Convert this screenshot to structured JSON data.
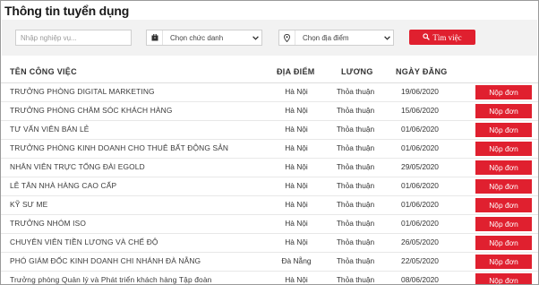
{
  "page": {
    "title": "Thông tin tuyển dụng"
  },
  "filters": {
    "keyword_placeholder": "Nhập nghiệp vụ...",
    "job_title_select": {
      "value": "Chọn chức danh",
      "icon": "briefcase-icon"
    },
    "location_select": {
      "value": "Chọn địa điểm",
      "icon": "map-marker-icon"
    },
    "search_button": {
      "label": "Tìm việc",
      "icon": "search-icon"
    }
  },
  "table": {
    "headers": {
      "title": "TÊN CÔNG VIỆC",
      "place": "ĐỊA ĐIỂM",
      "salary": "LƯƠNG",
      "date": "NGÀY ĐĂNG"
    },
    "apply_label": "Nộp đơn",
    "rows": [
      {
        "title": "TRƯỞNG PHÒNG DIGITAL MARKETING",
        "place": "Hà Nội",
        "salary": "Thỏa thuận",
        "date": "19/06/2020"
      },
      {
        "title": "TRƯỞNG PHÒNG CHĂM SÓC KHÁCH HÀNG",
        "place": "Hà Nội",
        "salary": "Thỏa thuận",
        "date": "15/06/2020"
      },
      {
        "title": "TƯ VẤN VIÊN BÁN LẺ",
        "place": "Hà Nội",
        "salary": "Thỏa thuận",
        "date": "01/06/2020"
      },
      {
        "title": "TRƯỞNG PHÒNG KINH DOANH CHO THUÊ BẤT ĐỘNG SẢN",
        "place": "Hà Nội",
        "salary": "Thỏa thuận",
        "date": "01/06/2020"
      },
      {
        "title": "NHÂN VIÊN TRỰC TỔNG ĐÀI EGOLD",
        "place": "Hà Nội",
        "salary": "Thỏa thuận",
        "date": "29/05/2020"
      },
      {
        "title": "LỄ TÂN NHÀ HÀNG CAO CẤP",
        "place": "Hà Nội",
        "salary": "Thỏa thuận",
        "date": "01/06/2020"
      },
      {
        "title": "KỸ SƯ ME",
        "place": "Hà Nội",
        "salary": "Thỏa thuận",
        "date": "01/06/2020"
      },
      {
        "title": "TRƯỞNG NHÓM ISO",
        "place": "Hà Nội",
        "salary": "Thỏa thuận",
        "date": "01/06/2020"
      },
      {
        "title": "CHUYÊN VIÊN TIỀN LƯƠNG VÀ CHẾ ĐỘ",
        "place": "Hà Nội",
        "salary": "Thỏa thuận",
        "date": "26/05/2020"
      },
      {
        "title": "PHÓ GIÁM ĐỐC KINH DOANH CHI NHÁNH ĐÀ NẴNG",
        "place": "Đà Nẵng",
        "salary": "Thỏa thuận",
        "date": "22/05/2020"
      },
      {
        "title": "Trưởng phòng Quản lý và Phát triển khách hàng Tập đoàn",
        "place": "Hà Nội",
        "salary": "Thỏa thuận",
        "date": "08/06/2020"
      }
    ]
  },
  "colors": {
    "accent": "#e0202f",
    "filter_bar": "#f2f2f2"
  }
}
